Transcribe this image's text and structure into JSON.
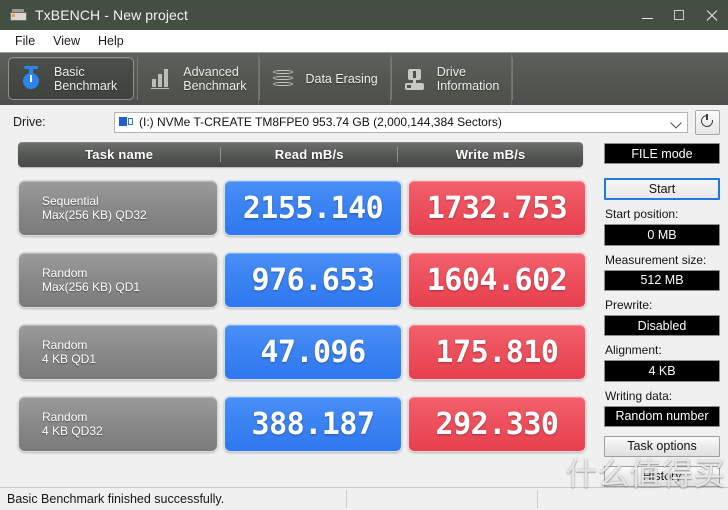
{
  "window": {
    "title": "TxBENCH - New project",
    "icon": "drive-icon",
    "minimize": "–",
    "maximize": "□",
    "close": "×"
  },
  "menu": {
    "items": [
      {
        "label": "File"
      },
      {
        "label": "View"
      },
      {
        "label": "Help"
      }
    ]
  },
  "tabs": [
    {
      "label": "Basic\nBenchmark",
      "icon": "stopwatch-icon",
      "active": true
    },
    {
      "label": "Advanced\nBenchmark",
      "icon": "bar-chart-icon",
      "active": false
    },
    {
      "label": "Data Erasing",
      "icon": "shredder-icon",
      "active": false
    },
    {
      "label": "Drive\nInformation",
      "icon": "drive-info-icon",
      "active": false
    }
  ],
  "drive": {
    "label": "Drive:",
    "selected": "(I:) NVMe T-CREATE TM8FPE0  953.74 GB (2,000,144,384 Sectors)",
    "refresh_icon": "refresh-icon",
    "dropdown_icon": "chevron-down-icon"
  },
  "results": {
    "columns": [
      "Task name",
      "Read mB/s",
      "Write mB/s"
    ],
    "rows": [
      {
        "task_line1": "Sequential",
        "task_line2": "Max(256 KB) QD32",
        "read": "2155.140",
        "write": "1732.753"
      },
      {
        "task_line1": "Random",
        "task_line2": "Max(256 KB) QD1",
        "read": "976.653",
        "write": "1604.602"
      },
      {
        "task_line1": "Random",
        "task_line2": "4 KB QD1",
        "read": "47.096",
        "write": "175.810"
      },
      {
        "task_line1": "Random",
        "task_line2": "4 KB QD32",
        "read": "388.187",
        "write": "292.330"
      }
    ]
  },
  "sidebar": {
    "mode_button": "FILE mode",
    "start_button": "Start",
    "start_position_label": "Start position:",
    "start_position_value": "0 MB",
    "measurement_size_label": "Measurement size:",
    "measurement_size_value": "512 MB",
    "prewrite_label": "Prewrite:",
    "prewrite_value": "Disabled",
    "alignment_label": "Alignment:",
    "alignment_value": "4 KB",
    "writing_data_label": "Writing data:",
    "writing_data_value": "Random number",
    "task_options_button": "Task options",
    "history_button": "History"
  },
  "status": {
    "message": "Basic Benchmark finished successfully."
  },
  "watermark": {
    "text": "什么值得买"
  },
  "colors": {
    "titlebar": "#434f40",
    "read_tile": "#3b82f2",
    "write_tile": "#ed4f5c",
    "tabstrip": "#53574f",
    "accent_blue": "#1f7ae0"
  }
}
